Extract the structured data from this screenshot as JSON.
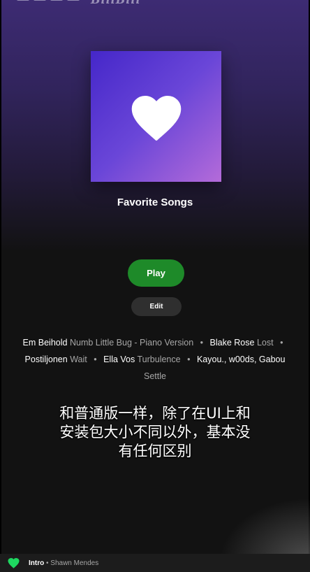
{
  "colors": {
    "play_green": "#1e8a29",
    "heart_green": "#1ed760",
    "background": "#121212"
  },
  "header": {
    "watermark_logo": "BiliBili"
  },
  "playlist": {
    "cover_icon": "heart-icon",
    "title": "Favorite Songs"
  },
  "actions": {
    "play_label": "Play",
    "edit_label": "Edit"
  },
  "tracks": [
    {
      "artist": "Em Beihold",
      "title": "Numb Little Bug - Piano Version"
    },
    {
      "artist": "Blake Rose",
      "title": "Lost"
    },
    {
      "artist": "Postiljonen",
      "title": "Wait"
    },
    {
      "artist": "Ella Vos",
      "title": "Turbulence"
    },
    {
      "artist": "Kayou., w00ds, Gabou",
      "title": "Settle"
    }
  ],
  "subtitle": {
    "lines": [
      "和普通版一样，除了在UI上和",
      "安装包大小不同以外，基本没",
      "有任何区别"
    ]
  },
  "now_playing": {
    "icon": "heart-icon",
    "song": "Intro",
    "separator": "•",
    "artist": "Shawn Mendes"
  }
}
